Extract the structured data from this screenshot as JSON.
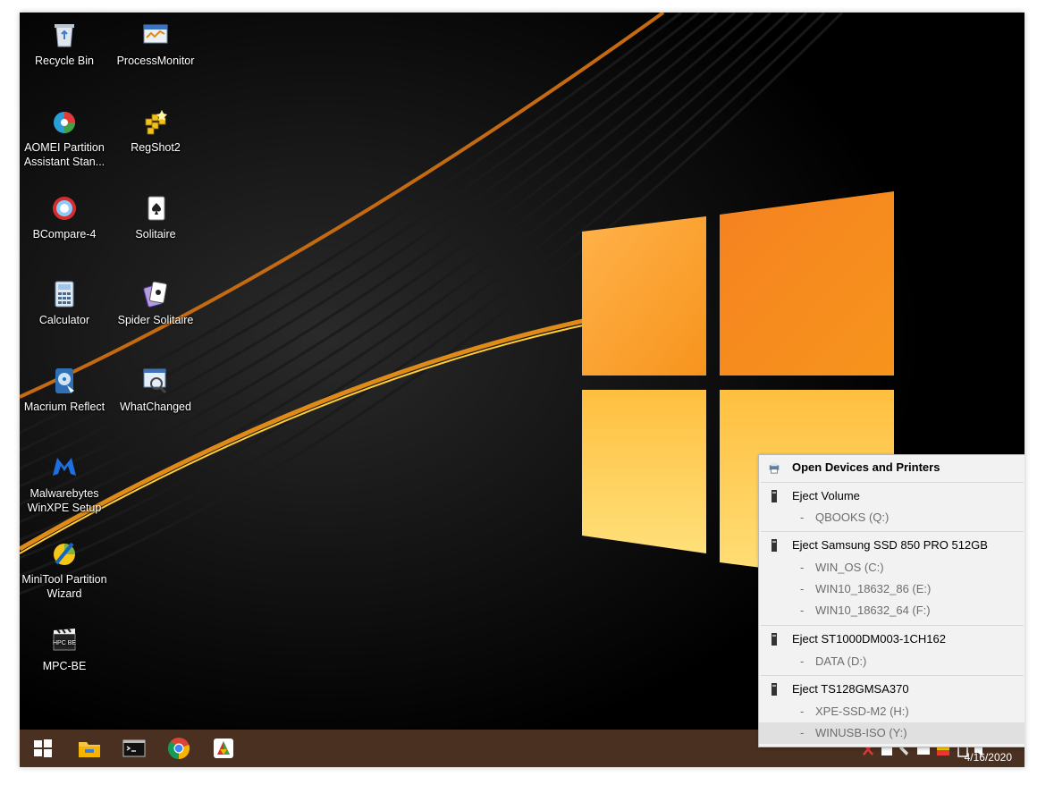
{
  "desktop": {
    "icons": [
      {
        "label": "Recycle Bin",
        "icon": "recycle-bin-icon"
      },
      {
        "label": "ProcessMonitor",
        "icon": "process-monitor-icon"
      },
      {
        "label": "AOMEI Partition Assistant Stan...",
        "icon": "aomei-icon"
      },
      {
        "label": "RegShot2",
        "icon": "regshot-icon"
      },
      {
        "label": "BCompare-4",
        "icon": "bcompare-icon"
      },
      {
        "label": "Solitaire",
        "icon": "solitaire-icon"
      },
      {
        "label": "Calculator",
        "icon": "calculator-icon"
      },
      {
        "label": "Spider Solitaire",
        "icon": "spider-solitaire-icon"
      },
      {
        "label": "Macrium Reflect",
        "icon": "macrium-icon"
      },
      {
        "label": "WhatChanged",
        "icon": "whatchanged-icon"
      },
      {
        "label": "Malwarebytes WinXPE Setup",
        "icon": "malwarebytes-icon"
      },
      {
        "label": "MiniTool Partition Wizard",
        "icon": "minitool-icon"
      },
      {
        "label": "MPC-BE",
        "icon": "mpc-be-icon"
      }
    ]
  },
  "taskbar": {
    "buttons": [
      "start-icon",
      "file-explorer-icon",
      "command-prompt-icon",
      "chrome-icon",
      "app-icon"
    ],
    "clock_date": "4/16/2020",
    "background": "#4a3020"
  },
  "eject_menu": {
    "open_devices": "Open Devices and Printers",
    "groups": [
      {
        "title": "Eject Volume",
        "volumes": [
          "QBOOKS (Q:)"
        ]
      },
      {
        "title": "Eject Samsung SSD 850 PRO 512GB",
        "volumes": [
          "WIN_OS (C:)",
          "WIN10_18632_86 (E:)",
          "WIN10_18632_64 (F:)"
        ]
      },
      {
        "title": "Eject ST1000DM003-1CH162",
        "volumes": [
          "DATA (D:)"
        ]
      },
      {
        "title": "Eject TS128GMSA370",
        "volumes": [
          "XPE-SSD-M2 (H:)",
          "WINUSB-ISO (Y:)"
        ]
      }
    ],
    "dash": "-"
  },
  "colors": {
    "accent_orange": "#f7931e",
    "menu_bg": "#f2f2f2"
  }
}
